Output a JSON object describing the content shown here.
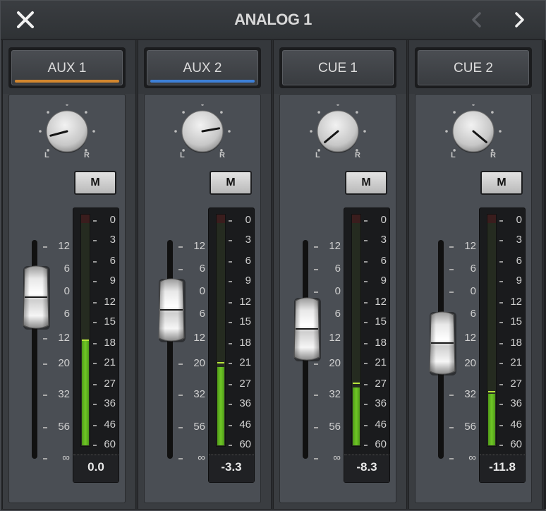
{
  "window": {
    "title": "ANALOG 1"
  },
  "icons": {
    "close": "close-icon",
    "prev": "chevron-left-icon",
    "next": "chevron-right-icon"
  },
  "scale_labels": [
    "12",
    "6",
    "0",
    "6",
    "12",
    "20",
    "32",
    "56",
    "∞"
  ],
  "meter_labels": [
    "0",
    "3",
    "6",
    "9",
    "12",
    "15",
    "18",
    "21",
    "27",
    "36",
    "46",
    "60"
  ],
  "pan_left": "L",
  "pan_right": "R",
  "strips": [
    {
      "label": "AUX 1",
      "accent": "#d2862e",
      "mute": "M",
      "pan_angle": -105,
      "fader_db": 0.0,
      "value": "0.0",
      "meter_level": 0.47,
      "peak_level": 0.47
    },
    {
      "label": "AUX 2",
      "accent": "#3d7fd6",
      "mute": "M",
      "pan_angle": 80,
      "fader_db": -3.3,
      "value": "-3.3",
      "meter_level": 0.35,
      "peak_level": 0.37
    },
    {
      "label": "CUE 1",
      "accent": "",
      "mute": "M",
      "pan_angle": -130,
      "fader_db": -8.3,
      "value": "-8.3",
      "meter_level": 0.26,
      "peak_level": 0.28
    },
    {
      "label": "CUE 2",
      "accent": "",
      "mute": "M",
      "pan_angle": 130,
      "fader_db": -11.8,
      "value": "-11.8",
      "meter_level": 0.23,
      "peak_level": 0.24
    }
  ]
}
